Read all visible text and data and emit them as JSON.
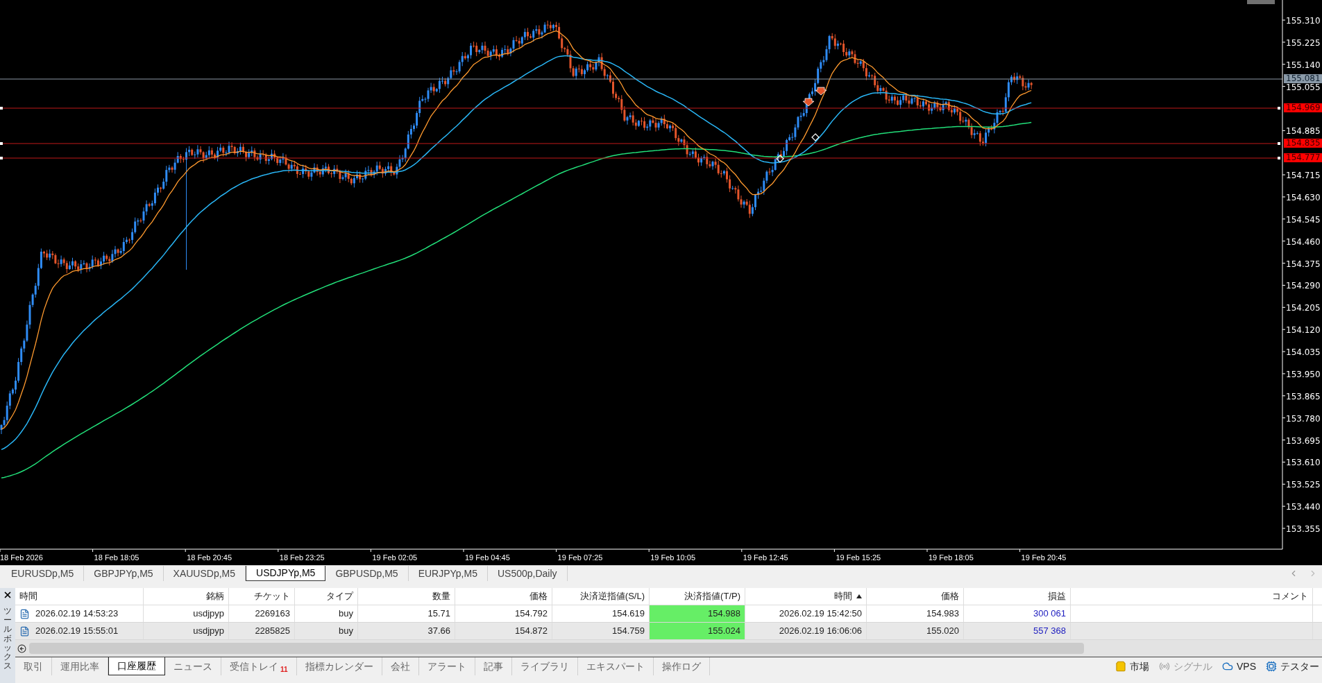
{
  "chart": {
    "price_scale": [
      "155.310",
      "155.225",
      "155.140",
      "155.055",
      "154.885",
      "154.715",
      "154.630",
      "154.545",
      "154.460",
      "154.375",
      "154.290",
      "154.205",
      "154.120",
      "154.035",
      "153.950",
      "153.865",
      "153.780",
      "153.695",
      "153.610",
      "153.525",
      "153.440",
      "153.355"
    ],
    "price_labels": [
      {
        "text": "155.081",
        "kind": "current"
      },
      {
        "text": "154.969",
        "kind": "level"
      },
      {
        "text": "154.835",
        "kind": "level"
      },
      {
        "text": "154.777",
        "kind": "level"
      }
    ],
    "time_scale": [
      "18 Feb 2026",
      "18 Feb 18:05",
      "18 Feb 20:45",
      "18 Feb 23:25",
      "19 Feb 02:05",
      "19 Feb 04:45",
      "19 Feb 07:25",
      "19 Feb 10:05",
      "19 Feb 12:45",
      "19 Feb 15:25",
      "19 Feb 18:05",
      "19 Feb 20:45"
    ]
  },
  "symbol_tabs": [
    {
      "label": "EURUSDp,M5",
      "selected": false
    },
    {
      "label": "GBPJPYp,M5",
      "selected": false
    },
    {
      "label": "XAUUSDp,M5",
      "selected": false
    },
    {
      "label": "USDJPYp,M5",
      "selected": true
    },
    {
      "label": "GBPUSDp,M5",
      "selected": false
    },
    {
      "label": "EURJPYp,M5",
      "selected": false
    },
    {
      "label": "US500p,Daily",
      "selected": false
    }
  ],
  "toolbox": {
    "title": "ツールボックス",
    "table": {
      "columns": [
        {
          "label": "時間",
          "kind": "left",
          "sorted": false
        },
        {
          "label": "銘柄",
          "kind": "right",
          "sorted": false
        },
        {
          "label": "チケット",
          "kind": "right",
          "sorted": false
        },
        {
          "label": "タイプ",
          "kind": "right",
          "sorted": false
        },
        {
          "label": "数量",
          "kind": "right",
          "sorted": false
        },
        {
          "label": "価格",
          "kind": "right",
          "sorted": false
        },
        {
          "label": "決済逆指値(S/L)",
          "kind": "right",
          "sorted": false
        },
        {
          "label": "決済指値(T/P)",
          "kind": "tp",
          "sorted": false
        },
        {
          "label": "時間",
          "kind": "right",
          "sorted": true
        },
        {
          "label": "価格",
          "kind": "right",
          "sorted": false
        },
        {
          "label": "損益",
          "kind": "profit",
          "sorted": false
        },
        {
          "label": "コメント",
          "kind": "right",
          "sorted": false
        }
      ],
      "rows": [
        {
          "cells": [
            "2026.02.19 14:53:23",
            "usdjpyp",
            "2269163",
            "buy",
            "15.71",
            "154.792",
            "154.619",
            "154.988",
            "2026.02.19 15:42:50",
            "154.983",
            "300 061"
          ]
        },
        {
          "cells": [
            "2026.02.19 15:55:01",
            "usdjpyp",
            "2285825",
            "buy",
            "37.66",
            "154.872",
            "154.759",
            "155.024",
            "2026.02.19 16:06:06",
            "155.020",
            "557 368"
          ]
        }
      ]
    },
    "tabs": [
      {
        "label": "取引",
        "selected": false
      },
      {
        "label": "運用比率",
        "selected": false
      },
      {
        "label": "口座履歴",
        "selected": true
      },
      {
        "label": "ニュース",
        "selected": false
      },
      {
        "label": "受信トレイ",
        "selected": false,
        "badge": "11"
      },
      {
        "label": "指標カレンダー",
        "selected": false
      },
      {
        "label": "会社",
        "selected": false
      },
      {
        "label": "アラート",
        "selected": false
      },
      {
        "label": "記事",
        "selected": false
      },
      {
        "label": "ライブラリ",
        "selected": false
      },
      {
        "label": "エキスパート",
        "selected": false
      },
      {
        "label": "操作ログ",
        "selected": false
      }
    ],
    "status_items": [
      {
        "label": "市場",
        "kind": "market",
        "disabled": false
      },
      {
        "label": "シグナル",
        "kind": "signal",
        "disabled": true
      },
      {
        "label": "VPS",
        "kind": "vps",
        "disabled": false
      },
      {
        "label": "テスター",
        "kind": "tester",
        "disabled": false
      }
    ]
  }
}
